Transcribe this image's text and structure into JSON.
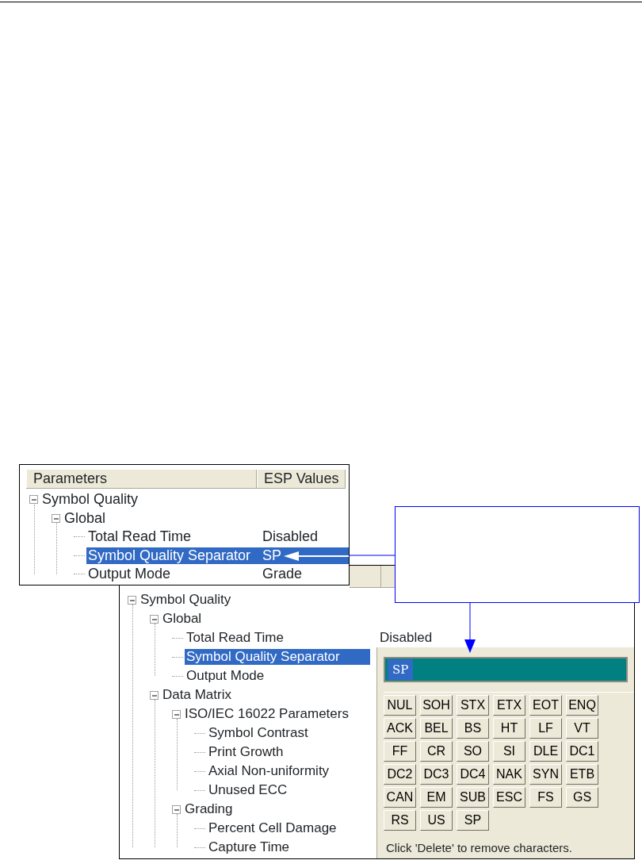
{
  "front_window": {
    "columns": [
      "Parameters",
      "ESP Values"
    ],
    "tree": [
      {
        "label": "Symbol Quality",
        "expanded": true,
        "children": [
          {
            "label": "Global",
            "expanded": true,
            "children": [
              {
                "label": "Total Read Time",
                "value": "Disabled",
                "selected": false
              },
              {
                "label": "Symbol Quality Separator",
                "value": "SP",
                "selected": true
              },
              {
                "label": "Output Mode",
                "value": "Grade",
                "selected": false
              }
            ]
          }
        ]
      }
    ]
  },
  "back_window": {
    "tree": [
      {
        "label": "Symbol Quality",
        "expanded": true,
        "children": [
          {
            "label": "Global",
            "expanded": true,
            "children": [
              {
                "label": "Total Read Time",
                "value": "Disabled",
                "selected": false
              },
              {
                "label": "Symbol Quality Separator",
                "selected": true
              },
              {
                "label": "Output Mode",
                "selected": false
              }
            ]
          },
          {
            "label": "Data Matrix",
            "expanded": true,
            "children": [
              {
                "label": "ISO/IEC 16022 Parameters",
                "expanded": true,
                "children": [
                  {
                    "label": "Symbol Contrast",
                    "selected": false
                  },
                  {
                    "label": "Print Growth",
                    "selected": false
                  },
                  {
                    "label": "Axial Non-uniformity",
                    "selected": false
                  },
                  {
                    "label": "Unused ECC",
                    "selected": false
                  }
                ]
              },
              {
                "label": "Grading",
                "expanded": true,
                "children": [
                  {
                    "label": "Percent Cell Damage",
                    "selected": false
                  },
                  {
                    "label": "Capture Time",
                    "selected": false
                  }
                ]
              }
            ]
          }
        ]
      }
    ],
    "editor": {
      "value": "SP",
      "keys": [
        "NUL",
        "SOH",
        "STX",
        "ETX",
        "EOT",
        "ENQ",
        "ACK",
        "BEL",
        "BS",
        "HT",
        "LF",
        "VT",
        "FF",
        "CR",
        "SO",
        "SI",
        "DLE",
        "DC1",
        "DC2",
        "DC3",
        "DC4",
        "NAK",
        "SYN",
        "ETB",
        "CAN",
        "EM",
        "SUB",
        "ESC",
        "FS",
        "GS",
        "RS",
        "US",
        "SP"
      ],
      "hint": "Click 'Delete' to remove characters."
    }
  }
}
